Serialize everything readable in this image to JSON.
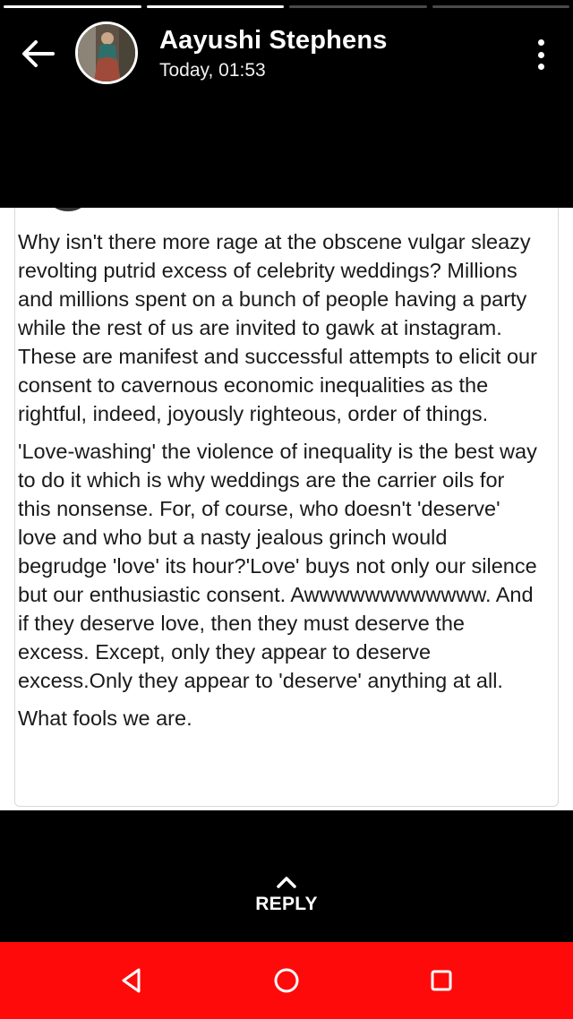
{
  "story": {
    "progress_segments": [
      {
        "state": "done"
      },
      {
        "state": "active"
      },
      {
        "state": "pending"
      },
      {
        "state": "pending"
      }
    ]
  },
  "header": {
    "back_icon": "arrow-left-icon",
    "contact_name": "Aayushi Stephens",
    "timestamp": "Today, 01:53",
    "menu_icon": "more-vertical-icon"
  },
  "post": {
    "paragraphs": [
      "Why isn't there more rage at the obscene vulgar sleazy revolting putrid excess of celebrity weddings? Millions and millions spent on a bunch of people having a party while the rest of us are invited to gawk at instagram. These are manifest and successful attempts to elicit our consent to cavernous economic inequalities as the rightful, indeed, joyously righteous, order of things.",
      "'Love-washing' the violence of inequality is the best way to do it which is why weddings are the carrier oils for this nonsense. For, of course, who doesn't 'deserve' love and who but a nasty jealous grinch would begrudge 'love' its hour?'Love' buys not only our silence but our enthusiastic consent. Awwwwwwwwwwww. And if they deserve love, then they must deserve the excess. Except, only they appear to deserve excess.Only they appear to 'deserve' anything at all.",
      "What fools we are."
    ]
  },
  "reply": {
    "icon": "chevron-up-icon",
    "label": "REPLY"
  },
  "navbar": {
    "back_icon": "nav-back-triangle-icon",
    "home_icon": "nav-home-circle-icon",
    "recents_icon": "nav-recents-square-icon",
    "color": "#ff0a0a"
  }
}
